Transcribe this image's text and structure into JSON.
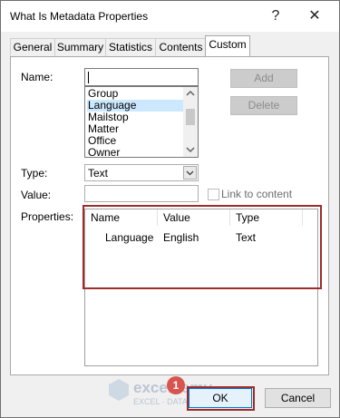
{
  "window": {
    "title": "What Is Metadata Properties",
    "help_label": "?",
    "close_label": "✕"
  },
  "tabs": [
    {
      "label": "General"
    },
    {
      "label": "Summary"
    },
    {
      "label": "Statistics"
    },
    {
      "label": "Contents"
    },
    {
      "label": "Custom"
    }
  ],
  "form": {
    "name_label": "Name:",
    "name_value": "",
    "name_list": [
      "Group",
      "Language",
      "Mailstop",
      "Matter",
      "Office",
      "Owner"
    ],
    "selected_name": "Language",
    "add_label": "Add",
    "delete_label": "Delete",
    "type_label": "Type:",
    "type_value": "Text",
    "value_label": "Value:",
    "value_value": "",
    "link_label": "Link to content",
    "properties_label": "Properties:"
  },
  "properties_table": {
    "columns": [
      "Name",
      "Value",
      "Type"
    ],
    "rows": [
      {
        "name": "Language",
        "value": "English",
        "type": "Text"
      }
    ]
  },
  "footer": {
    "ok_label": "OK",
    "cancel_label": "Cancel"
  },
  "annotation": {
    "step": "1",
    "accent": "#9b2d2d"
  },
  "watermark": {
    "text": "exceldemy",
    "subtext": "EXCEL · DATA · BI"
  },
  "icons": {
    "dropdown": "chevron-down-icon",
    "scroll_up": "scroll-up-icon",
    "scroll_down": "scroll-down-icon"
  }
}
